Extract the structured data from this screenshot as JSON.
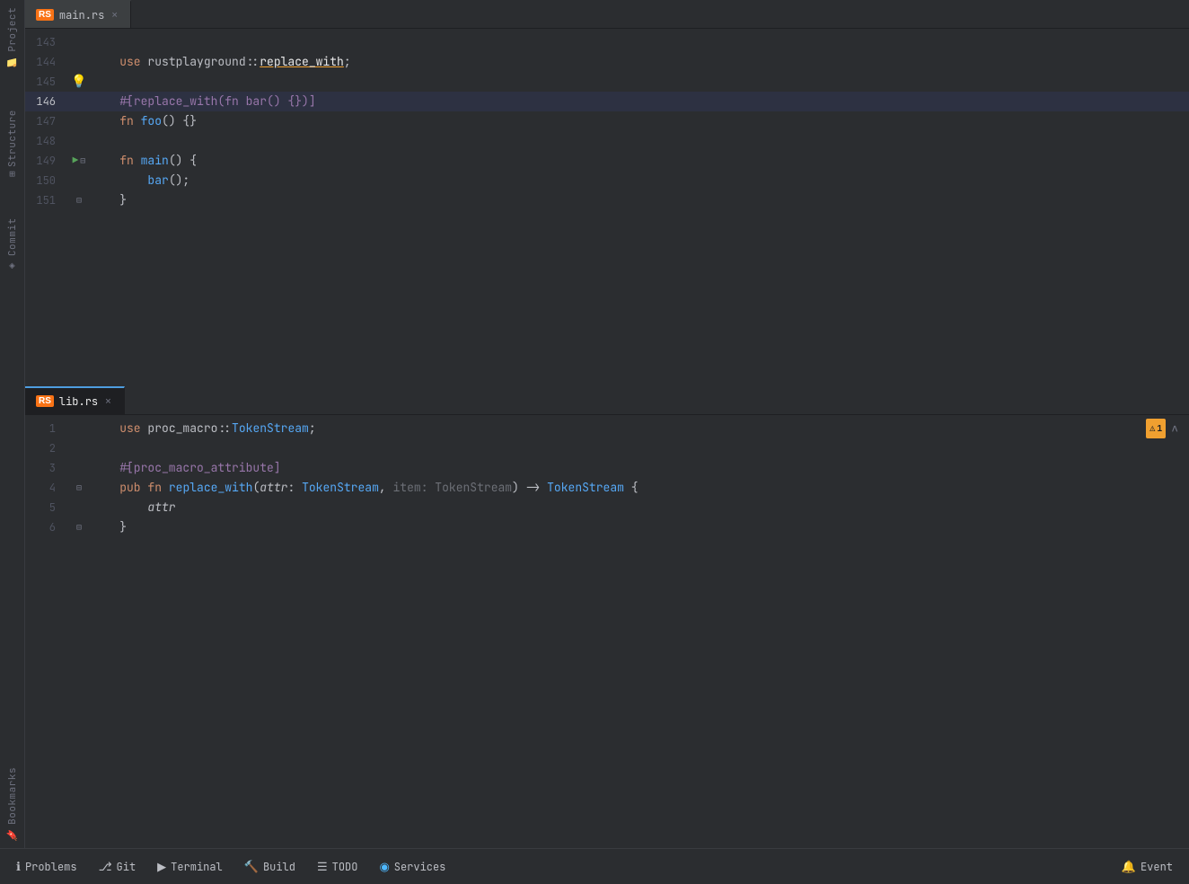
{
  "tabs": {
    "main_rs": {
      "label": "main.rs",
      "icon": "RS",
      "active": false
    },
    "lib_rs": {
      "label": "lib.rs",
      "icon": "RS",
      "active": true
    }
  },
  "side_tools": [
    {
      "name": "project",
      "label": "Project"
    },
    {
      "name": "structure",
      "label": "Structure"
    },
    {
      "name": "commit",
      "label": "Commit"
    },
    {
      "name": "bookmarks",
      "label": "Bookmarks"
    }
  ],
  "main_rs_lines": [
    {
      "num": "143",
      "content": ""
    },
    {
      "num": "144",
      "content": "    use rustplayground::replace_with;"
    },
    {
      "num": "145",
      "content": "",
      "bulb": true
    },
    {
      "num": "146",
      "content": "    #[replace_with(fn bar() {})]",
      "highlight": true
    },
    {
      "num": "147",
      "content": "    fn foo() {}"
    },
    {
      "num": "148",
      "content": ""
    },
    {
      "num": "149",
      "content": "    fn main() {",
      "run": true,
      "fold": true
    },
    {
      "num": "150",
      "content": "        bar();"
    },
    {
      "num": "151",
      "content": "    }",
      "fold": true
    }
  ],
  "lib_rs_lines": [
    {
      "num": "1",
      "content": "    use proc_macro::TokenStream;",
      "warning": true
    },
    {
      "num": "2",
      "content": ""
    },
    {
      "num": "3",
      "content": "    #[proc_macro_attribute]"
    },
    {
      "num": "4",
      "content": "    pub fn replace_with(attr: TokenStream, item: TokenStream) -> TokenStream {",
      "fold": true
    },
    {
      "num": "5",
      "content": "        attr"
    },
    {
      "num": "6",
      "content": "    }",
      "fold": true
    }
  ],
  "status_bar": {
    "items": [
      {
        "name": "problems",
        "icon": "ℹ",
        "label": "Problems"
      },
      {
        "name": "git",
        "icon": "⎇",
        "label": "Git"
      },
      {
        "name": "terminal",
        "icon": "▶",
        "label": "Terminal"
      },
      {
        "name": "build",
        "icon": "🔨",
        "label": "Build"
      },
      {
        "name": "todo",
        "icon": "☰",
        "label": "TODO"
      },
      {
        "name": "services",
        "icon": "▶",
        "label": "Services"
      }
    ],
    "right_item": {
      "name": "event",
      "icon": "🔔",
      "label": "Event"
    }
  },
  "colors": {
    "keyword": "#cf8e6d",
    "function": "#56a8f5",
    "type": "#56a8f5",
    "string": "#6aab73",
    "comment": "#7a7e85",
    "accent": "#4e9de0",
    "warning": "#f0a030",
    "success": "#57a35a",
    "bg_editor": "#1e1f22",
    "bg_main": "#2b2d30",
    "bg_tab_active": "#1e1f22",
    "text_main": "#bcbec4"
  }
}
